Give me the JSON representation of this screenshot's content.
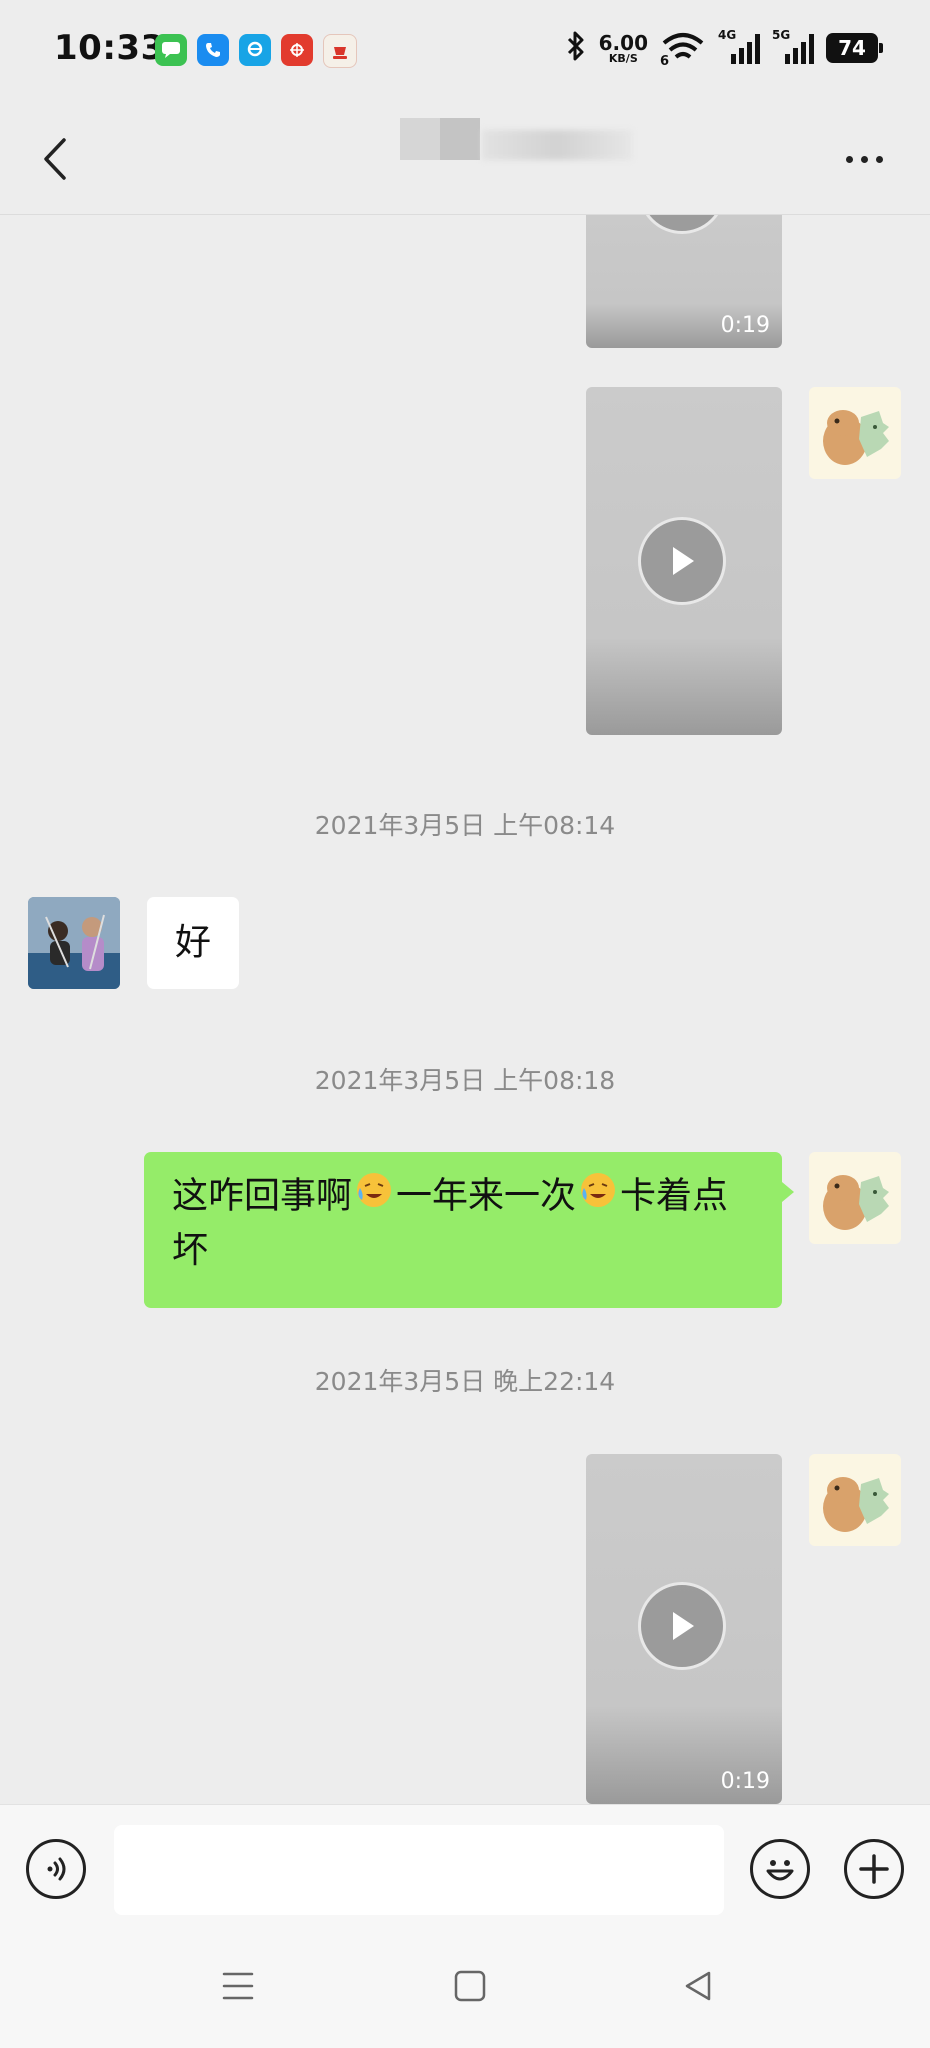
{
  "status_bar": {
    "time": "10:33",
    "net_speed_value": "6.00",
    "net_speed_unit": "KB/S",
    "wifi_label": "6",
    "signal1_label": "4G",
    "signal2_label": "5G",
    "battery": "74"
  },
  "header": {
    "back_icon": "chevron-left-icon",
    "more_icon": "more-dots-icon"
  },
  "messages": {
    "video1_duration": "0:19",
    "video3_duration": "0:19",
    "timestamp1": "2021年3月5日 上午08:14",
    "reply_text": "好",
    "timestamp2": "2021年3月5日 上午08:18",
    "sent_text_1": "这咋回事啊",
    "sent_text_2": "一年来一次",
    "sent_text_3": "卡着点坏",
    "timestamp3": "2021年3月5日 晚上22:14"
  },
  "colors": {
    "sent_bubble": "#95ec69",
    "received_bubble": "#ffffff",
    "background": "#ededed"
  }
}
